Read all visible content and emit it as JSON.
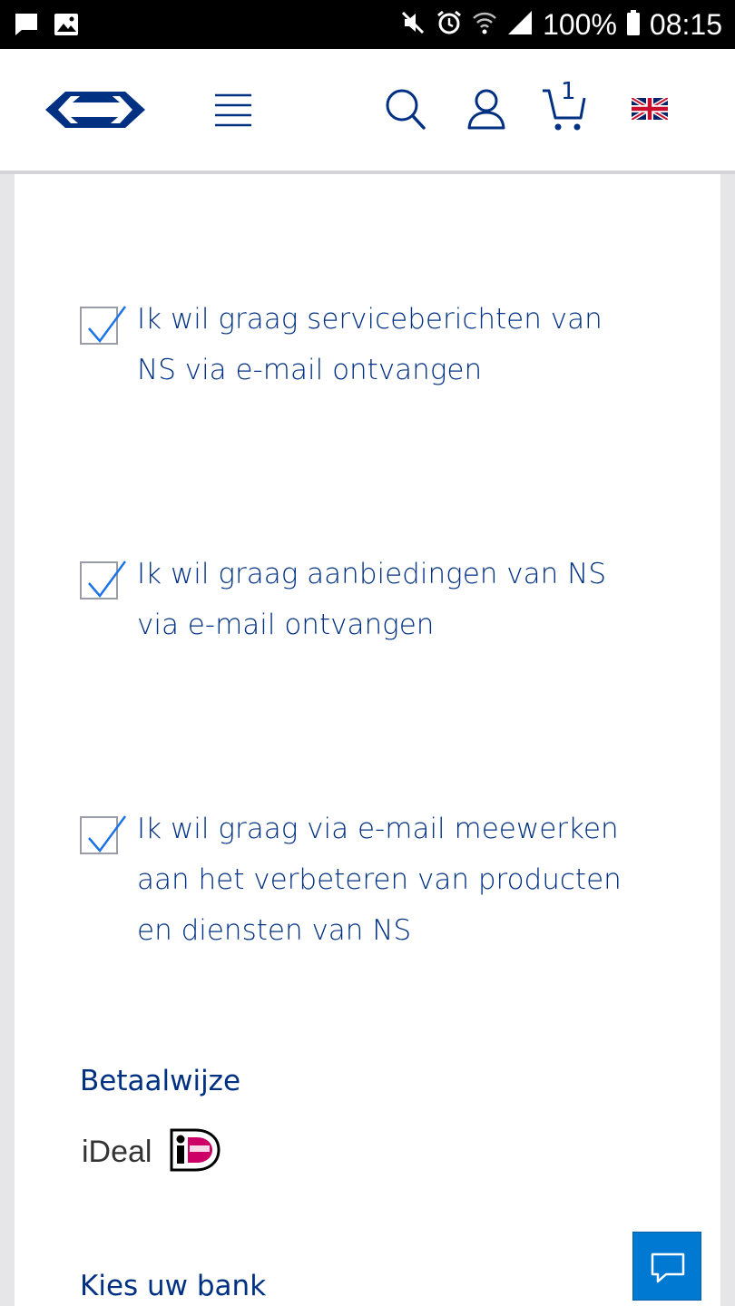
{
  "status_bar": {
    "battery_percent": "100%",
    "time": "08:15"
  },
  "header": {
    "logo_icon": "ns-logo-icon",
    "menu_icon": "hamburger-menu-icon",
    "search_icon": "search-icon",
    "account_icon": "user-icon",
    "cart_count": "1",
    "language_icon": "uk-flag-icon"
  },
  "preferences": [
    {
      "label": "Ik wil graag serviceberichten van NS via e-mail ontvangen",
      "checked": true
    },
    {
      "label": "Ik wil graag aanbiedingen van NS via e-mail ontvangen",
      "checked": true
    },
    {
      "label": "Ik wil graag via e-mail meewerken aan het verbeteren van producten en diensten van NS",
      "checked": true
    }
  ],
  "payment": {
    "title": "Betaalwijze",
    "method": "iDeal",
    "logo_icon": "ideal-logo-icon"
  },
  "bank": {
    "title": "Kies uw bank"
  },
  "chat": {
    "icon": "chat-bubble-icon"
  },
  "colors": {
    "brand_blue": "#003082",
    "accent_blue": "#0079d3",
    "check_blue": "#1a73e8"
  }
}
